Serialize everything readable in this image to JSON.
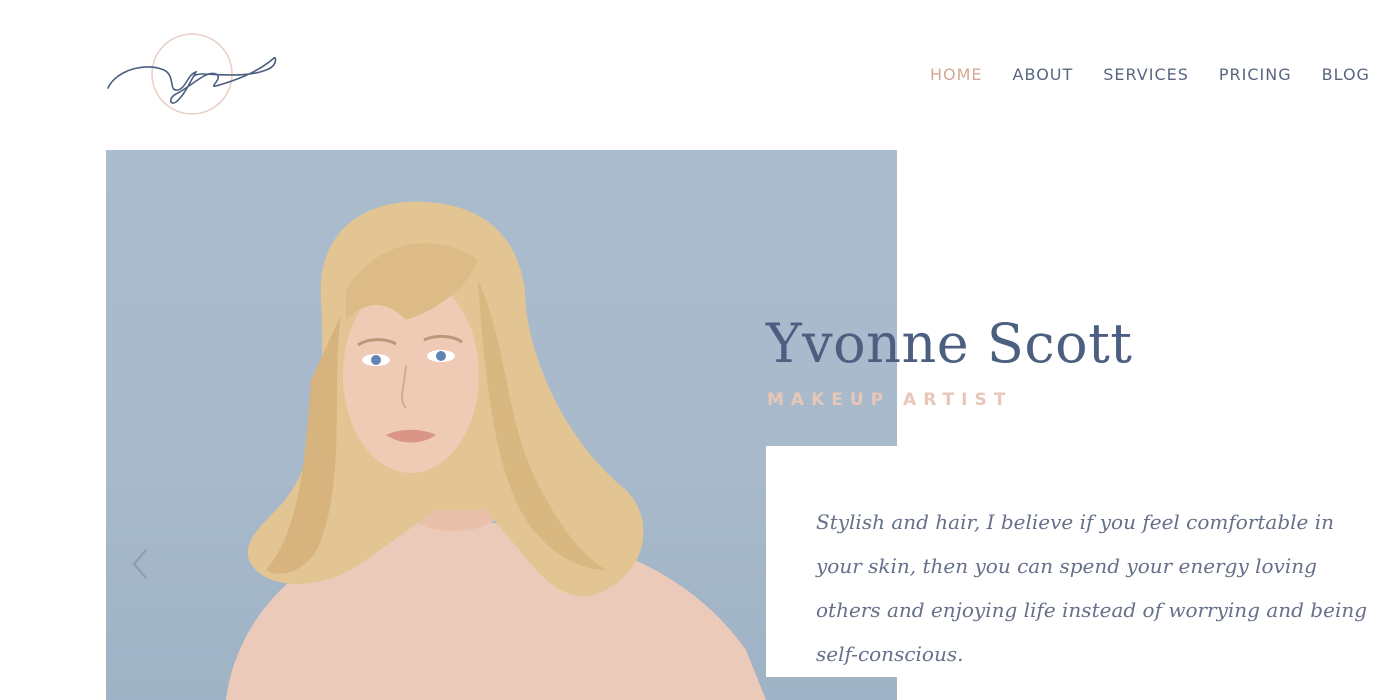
{
  "logo": {
    "monogram": "ys"
  },
  "nav": {
    "items": [
      {
        "label": "HOME",
        "active": true
      },
      {
        "label": "ABOUT",
        "active": false
      },
      {
        "label": "SERVICES",
        "active": false
      },
      {
        "label": "PRICING",
        "active": false
      },
      {
        "label": "BLOG",
        "active": false
      }
    ]
  },
  "hero": {
    "name": "Yvonne Scott",
    "subtitle": "MAKEUP ARTIST",
    "quote": "Stylish and hair, I believe if you feel comfortable in your skin, then you can spend your energy loving others and enjoying life instead of worrying and being self-conscious.",
    "prev_icon": "chevron-left-icon"
  },
  "colors": {
    "accent": "#d6a893",
    "text_primary": "#4d5f80",
    "photo_background": "#a9bbcc",
    "subtitle": "#e8c6b8"
  }
}
